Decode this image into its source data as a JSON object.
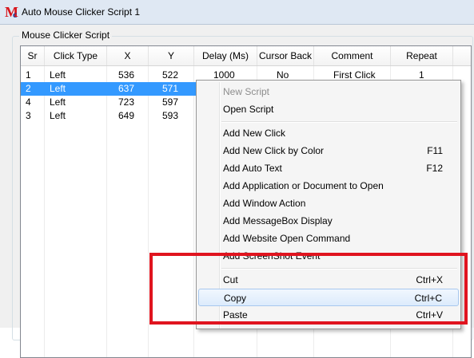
{
  "window": {
    "title": "Auto Mouse Clicker Script 1"
  },
  "group": {
    "label": "Mouse Clicker Script"
  },
  "table": {
    "columns": [
      "Sr",
      "Click Type",
      "X",
      "Y",
      "Delay (Ms)",
      "Cursor Back",
      "Comment",
      "Repeat"
    ],
    "rows": [
      [
        "1",
        "Left",
        "536",
        "522",
        "1000",
        "No",
        "First Click",
        "1"
      ],
      [
        "2",
        "Left",
        "637",
        "571",
        "",
        "",
        "",
        ""
      ],
      [
        "4",
        "Left",
        "723",
        "597",
        "",
        "",
        "",
        ""
      ],
      [
        "3",
        "Left",
        "649",
        "593",
        "",
        "",
        "",
        ""
      ]
    ],
    "selected_row_index": 1
  },
  "context_menu": {
    "items": [
      {
        "label": "New Script",
        "shortcut": "",
        "disabled": true
      },
      {
        "label": "Open Script",
        "shortcut": ""
      },
      {
        "label": "Add New Click",
        "shortcut": ""
      },
      {
        "label": "Add New Click by Color",
        "shortcut": "F11"
      },
      {
        "label": "Add Auto Text",
        "shortcut": "F12"
      },
      {
        "label": "Add Application or Document to Open",
        "shortcut": ""
      },
      {
        "label": "Add Window Action",
        "shortcut": ""
      },
      {
        "label": "Add MessageBox Display",
        "shortcut": ""
      },
      {
        "label": "Add Website Open Command",
        "shortcut": ""
      },
      {
        "label": "Add ScreenShot Event",
        "shortcut": ""
      },
      {
        "label": "Cut",
        "shortcut": "Ctrl+X"
      },
      {
        "label": "Copy",
        "shortcut": "Ctrl+C",
        "hovered": true
      },
      {
        "label": "Paste",
        "shortcut": "Ctrl+V"
      }
    ]
  },
  "colors": {
    "selection": "#3399ff",
    "annotation_box": "#e0141f",
    "icon_red": "#d8141b"
  }
}
